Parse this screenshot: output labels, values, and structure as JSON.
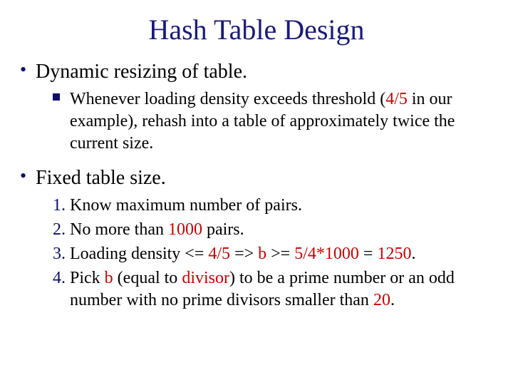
{
  "title": "Hash Table Design",
  "bullets": [
    {
      "text": "Dynamic resizing of table.",
      "subs": [
        {
          "type": "square",
          "parts": [
            {
              "t": "Whenever loading density exceeds threshold ("
            },
            {
              "t": "4/5",
              "red": true
            },
            {
              "t": " in our example), rehash into a table of approximately twice the current size."
            }
          ]
        }
      ]
    },
    {
      "text": "Fixed table size.",
      "subs": [
        {
          "type": "num",
          "n": "1.",
          "parts": [
            {
              "t": "Know maximum number of pairs."
            }
          ]
        },
        {
          "type": "num",
          "n": "2.",
          "parts": [
            {
              "t": "No more than "
            },
            {
              "t": "1000",
              "red": true
            },
            {
              "t": " pairs."
            }
          ]
        },
        {
          "type": "num",
          "n": "3.",
          "parts": [
            {
              "t": "Loading density <= "
            },
            {
              "t": "4/5",
              "red": true
            },
            {
              "t": " => "
            },
            {
              "t": "b",
              "red": true
            },
            {
              "t": " >= "
            },
            {
              "t": "5/4*1000",
              "red": true
            },
            {
              "t": " = "
            },
            {
              "t": "1250",
              "red": true
            },
            {
              "t": "."
            }
          ]
        },
        {
          "type": "num",
          "n": "4.",
          "parts": [
            {
              "t": "Pick "
            },
            {
              "t": "b",
              "red": true
            },
            {
              "t": " (equal to "
            },
            {
              "t": "divisor",
              "red": true
            },
            {
              "t": ") to be a prime number or an odd number with no prime divisors smaller than "
            },
            {
              "t": "20",
              "red": true
            },
            {
              "t": "."
            }
          ]
        }
      ]
    }
  ]
}
